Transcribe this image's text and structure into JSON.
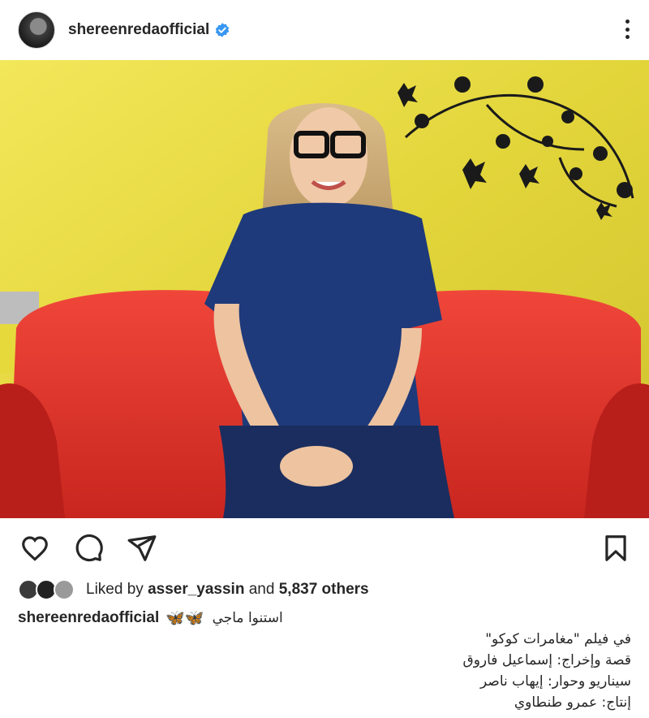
{
  "header": {
    "username": "shereenredaofficial",
    "verified_badge_color": "#3897f0"
  },
  "post": {
    "image_description_icons": [
      "woman-on-red-sofa-photo"
    ],
    "colors": {
      "wall": "#e3d63a",
      "sofa": "#e23a2c",
      "shirt": "#1f3a7a"
    }
  },
  "actions": {
    "like_icon": "heart-icon",
    "comment_icon": "comment-icon",
    "share_icon": "send-icon",
    "save_icon": "bookmark-icon"
  },
  "likes": {
    "prefix": "Liked by",
    "user": "asser_yassin",
    "joiner": "and",
    "others": "5,837 others"
  },
  "caption": {
    "username": "shereenredaofficial",
    "emoji": "🦋🦋",
    "first_line": "استنوا ماجي",
    "lines": [
      "في فيلم \"مغامرات كوكو\"",
      "قصة وإخراج: إسماعيل فاروق",
      "سيناريو وحوار: إيهاب ناصر",
      "إنتاج: عمرو طنطاوي"
    ]
  }
}
